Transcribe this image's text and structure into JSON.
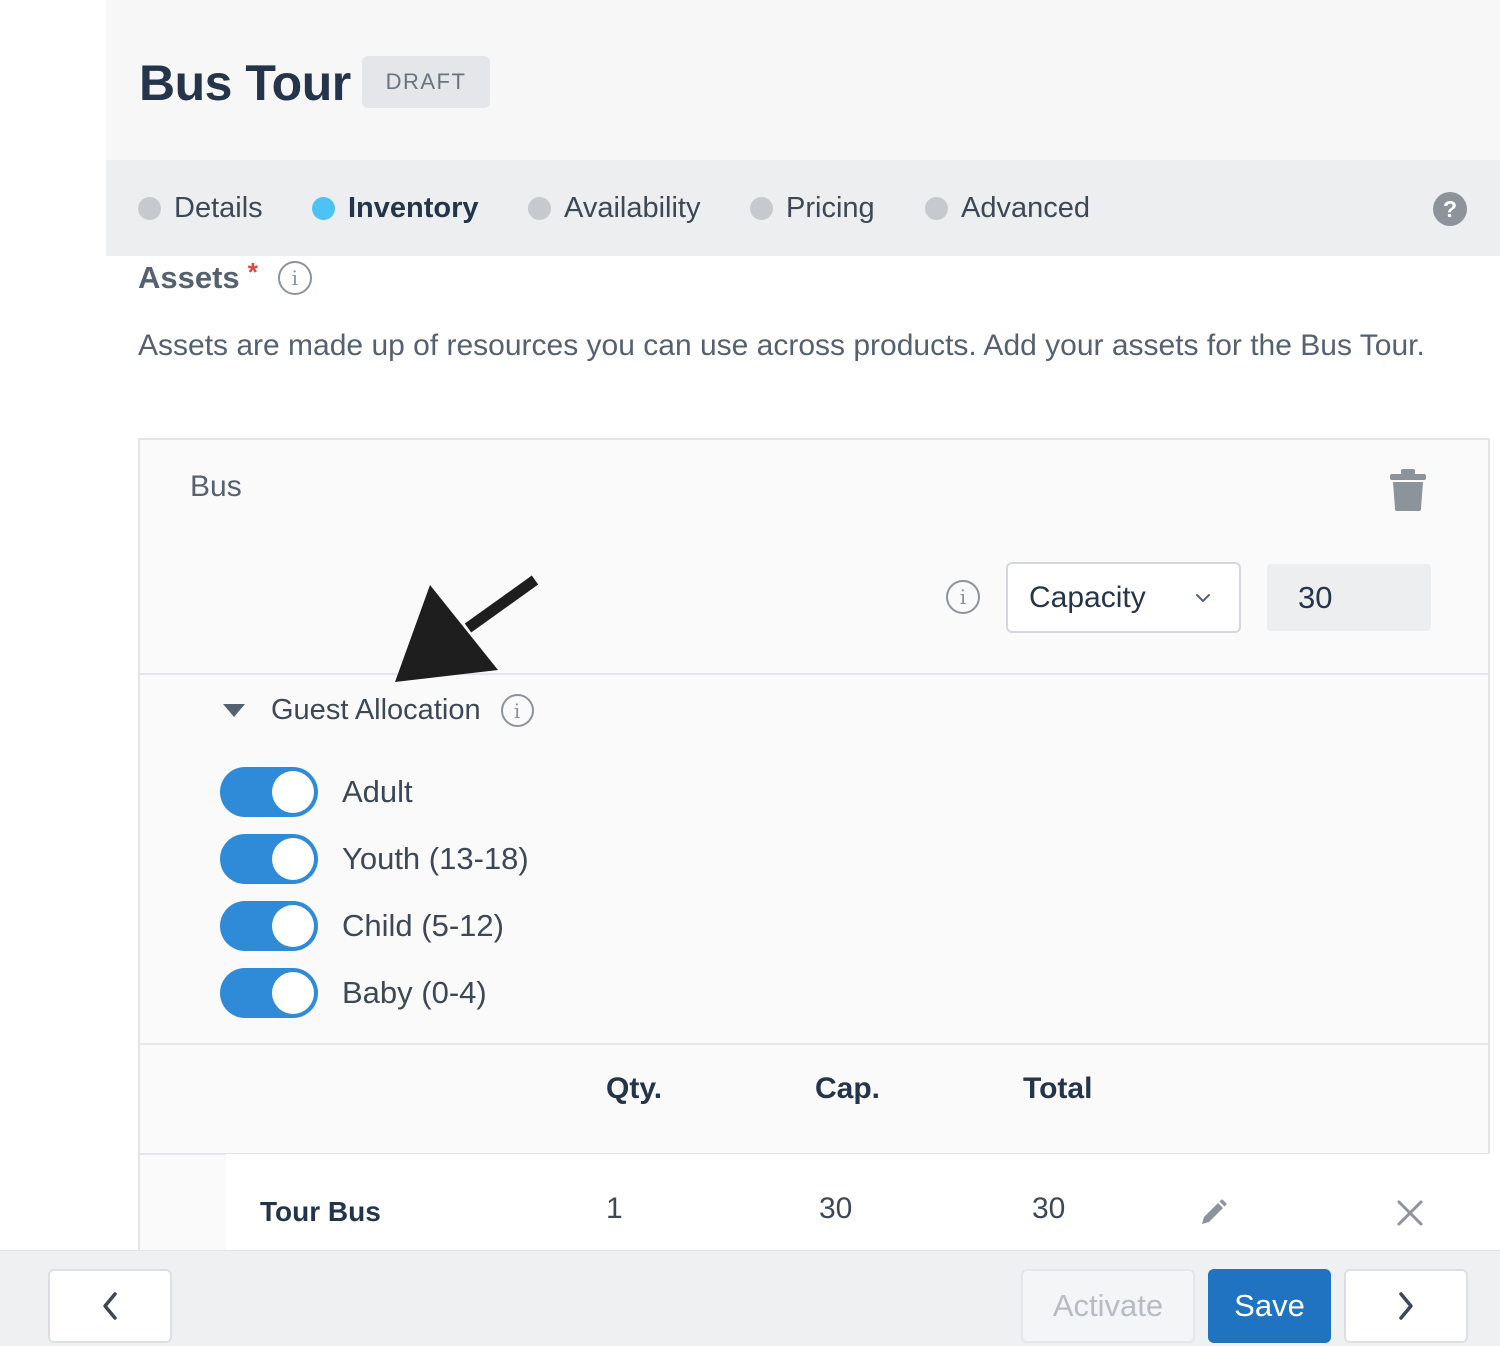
{
  "page": {
    "title": "Bus Tour",
    "status_badge": "DRAFT"
  },
  "tabs": [
    {
      "label": "Details",
      "active": false
    },
    {
      "label": "Inventory",
      "active": true
    },
    {
      "label": "Availability",
      "active": false
    },
    {
      "label": "Pricing",
      "active": false
    },
    {
      "label": "Advanced",
      "active": false
    }
  ],
  "help_icon": "?",
  "assets": {
    "title": "Assets",
    "required_mark": "*",
    "description": "Assets are made up of resources you can use across products. Add your assets for the Bus Tour.",
    "asset_name": "Bus",
    "inventory_type": "Capacity",
    "inventory_value": "30",
    "guest_allocation": {
      "title": "Guest Allocation",
      "expanded": true,
      "guests": [
        {
          "label": "Adult",
          "enabled": true
        },
        {
          "label": "Youth (13-18)",
          "enabled": true
        },
        {
          "label": "Child (5-12)",
          "enabled": true
        },
        {
          "label": "Baby (0-4)",
          "enabled": true
        }
      ]
    },
    "table": {
      "headers": {
        "qty": "Qty.",
        "cap": "Cap.",
        "total": "Total"
      },
      "rows": [
        {
          "name": "Tour Bus",
          "qty": "1",
          "cap": "30",
          "total": "30"
        }
      ]
    }
  },
  "icons": {
    "info": "info-icon",
    "trash": "trash-icon",
    "chevron": "chevron-down-icon",
    "pencil": "pencil-icon",
    "close": "close-icon",
    "annotation_arrow": "arrow-annotation"
  },
  "footer": {
    "activate_label": "Activate",
    "save_label": "Save"
  },
  "colors": {
    "accent": "#1f73c1",
    "toggle_on": "#2f8ad8",
    "active_tab_dot": "#4cc3f4",
    "required": "#e0463c"
  }
}
